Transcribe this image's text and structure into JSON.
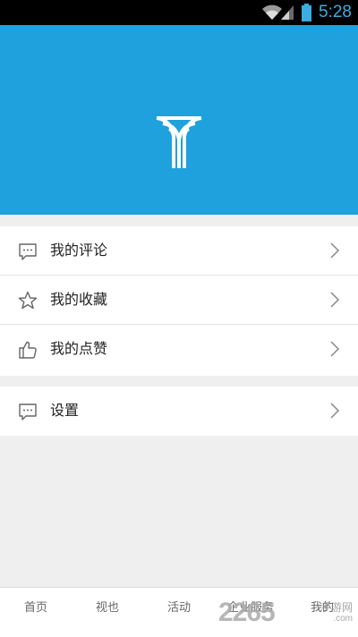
{
  "status_bar": {
    "time": "5:28",
    "icons": [
      "wifi-icon",
      "signal-icon",
      "battery-icon"
    ]
  },
  "header": {
    "logo": "app-logo",
    "background_color": "#1ea1dc"
  },
  "menu_groups": [
    {
      "items": [
        {
          "label": "我的评论",
          "icon": "comment-icon"
        },
        {
          "label": "我的收藏",
          "icon": "star-icon"
        },
        {
          "label": "我的点赞",
          "icon": "thumbs-up-icon"
        }
      ]
    },
    {
      "items": [
        {
          "label": "设置",
          "icon": "comment-icon"
        }
      ]
    }
  ],
  "tabs": [
    {
      "label": "首页"
    },
    {
      "label": "视也"
    },
    {
      "label": "活动"
    },
    {
      "label": "企业服务"
    },
    {
      "label": "我的"
    }
  ],
  "watermark": {
    "number": "2265",
    "text": "手游网",
    "url": ".com"
  }
}
